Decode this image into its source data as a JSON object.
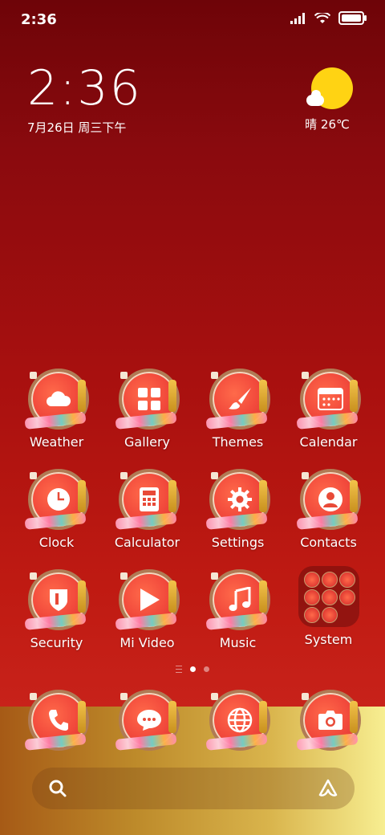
{
  "status_bar": {
    "time": "2:36",
    "battery_level": 1.0
  },
  "clock_widget": {
    "time": "2:36",
    "date": "7月26日 周三下午"
  },
  "weather_widget": {
    "condition_icon": "sun-cloud-icon",
    "text": "晴 26℃"
  },
  "apps": [
    {
      "label": "Weather",
      "icon": "cloud-icon"
    },
    {
      "label": "Gallery",
      "icon": "grid-icon"
    },
    {
      "label": "Themes",
      "icon": "brush-icon"
    },
    {
      "label": "Calendar",
      "icon": "calendar-icon"
    },
    {
      "label": "Clock",
      "icon": "clock-icon"
    },
    {
      "label": "Calculator",
      "icon": "calculator-icon"
    },
    {
      "label": "Settings",
      "icon": "gear-icon"
    },
    {
      "label": "Contacts",
      "icon": "person-icon"
    },
    {
      "label": "Security",
      "icon": "shield-icon"
    },
    {
      "label": "Mi Video",
      "icon": "play-icon"
    },
    {
      "label": "Music",
      "icon": "music-note-icon"
    },
    {
      "label": "System",
      "icon": "folder-icon"
    }
  ],
  "pager": {
    "pages": 2,
    "active_page": 1
  },
  "dock": [
    {
      "icon": "phone-icon"
    },
    {
      "icon": "message-icon"
    },
    {
      "icon": "globe-icon"
    },
    {
      "icon": "camera-icon"
    }
  ],
  "colors": {
    "wallpaper_top": "#6e0408",
    "wallpaper_mid": "#bf1a12",
    "dock_gold": "#d9b44c",
    "sun": "#ffd313"
  }
}
